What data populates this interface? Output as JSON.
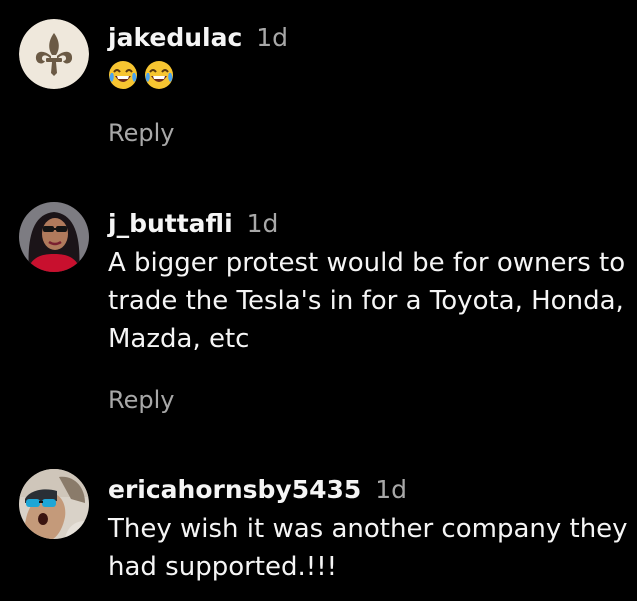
{
  "comments": [
    {
      "avatar": "fleur-de-lis-avatar",
      "username": "jakedulac",
      "time": "1d",
      "emojis": [
        "face-with-tears-of-joy",
        "face-with-tears-of-joy"
      ],
      "text": "",
      "reply_label": "Reply"
    },
    {
      "avatar": "user-photo-avatar",
      "username": "j_buttafli",
      "time": "1d",
      "text": "A bigger protest would be for owners to trade the Tesla's in for a Toyota, Honda, Mazda, etc",
      "reply_label": "Reply"
    },
    {
      "avatar": "user-photo-avatar",
      "username": "ericahornsby5435",
      "time": "1d",
      "text": "They wish it was another company they had supported.!!!"
    }
  ],
  "colors": {
    "background": "#000000",
    "primary_text": "#f5f5f5",
    "secondary_text": "#a8a8a8"
  }
}
